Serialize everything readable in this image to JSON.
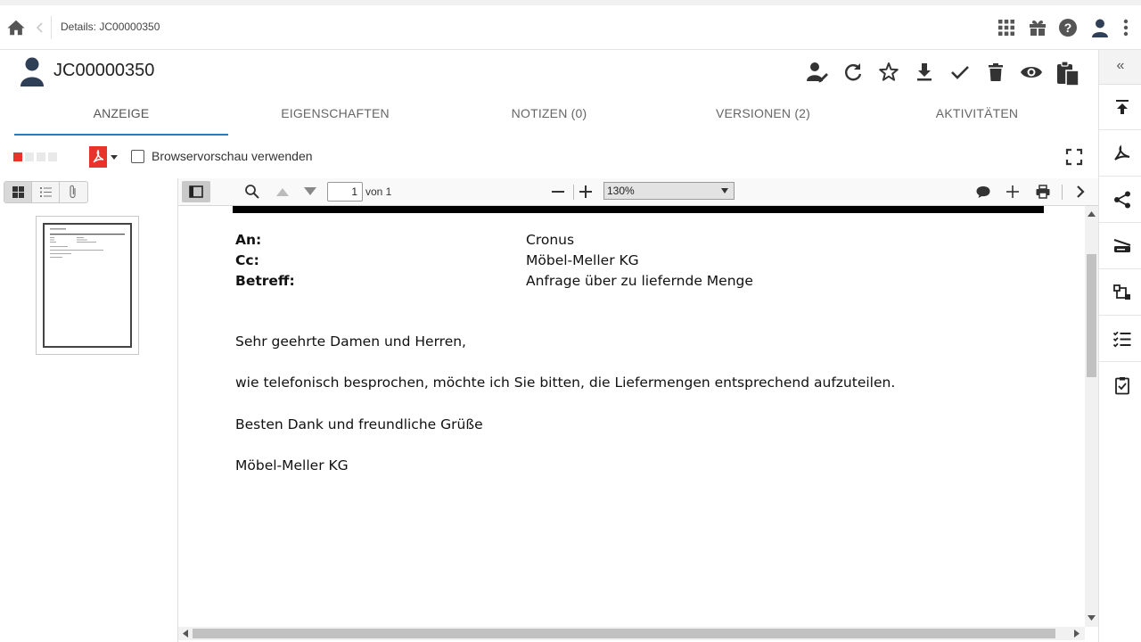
{
  "breadcrumb": {
    "label": "Details: JC00000350"
  },
  "header": {
    "title": "JC00000350"
  },
  "tabs": [
    {
      "label": "ANZEIGE",
      "active": true
    },
    {
      "label": "EIGENSCHAFTEN",
      "active": false
    },
    {
      "label": "NOTIZEN (0)",
      "active": false
    },
    {
      "label": "VERSIONEN (2)",
      "active": false
    },
    {
      "label": "AKTIVITÄTEN",
      "active": false
    }
  ],
  "preview": {
    "browser_preview_label": "Browservorschau verwenden",
    "browser_preview_checked": false
  },
  "pdf_toolbar": {
    "page_current": "1",
    "page_count_label": "von 1",
    "zoom_value": "130%"
  },
  "letter": {
    "fields": [
      {
        "label": "An:",
        "value": "Cronus"
      },
      {
        "label": "Cc:",
        "value": "Möbel-Meller KG"
      },
      {
        "label": "Betreff:",
        "value": "Anfrage über zu liefernde Menge"
      }
    ],
    "salutation": "Sehr geehrte Damen und Herren,",
    "body": "wie telefonisch besprochen, möchte ich Sie bitten, die Liefermengen entsprechend aufzuteilen.",
    "closing": "Besten Dank und freundliche Grüße",
    "signature": "Möbel-Meller KG"
  },
  "rail": {
    "collapse_label": "«"
  },
  "colors": {
    "accent": "#2b7bb9",
    "pdf_red": "#e8332b",
    "icon_dark": "#333333",
    "avatar": "#2f3f55"
  }
}
